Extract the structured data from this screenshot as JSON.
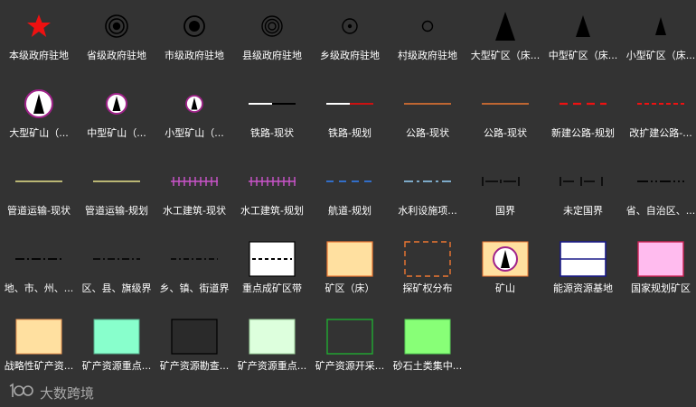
{
  "legend": [
    {
      "id": "r0c0",
      "icon": "red-star-icon",
      "label": "本级政府驻地"
    },
    {
      "id": "r0c1",
      "icon": "triple-ring-dot-icon",
      "label": "省级政府驻地"
    },
    {
      "id": "r0c2",
      "icon": "double-ring-dot-icon",
      "label": "市级政府驻地"
    },
    {
      "id": "r0c3",
      "icon": "triple-ring-icon",
      "label": "县级政府驻地"
    },
    {
      "id": "r0c4",
      "icon": "ring-dot-icon",
      "label": "乡级政府驻地"
    },
    {
      "id": "r0c5",
      "icon": "small-ring-icon",
      "label": "村级政府驻地"
    },
    {
      "id": "r0c6",
      "icon": "large-triangle-icon",
      "label": "大型矿区（床..."
    },
    {
      "id": "r0c7",
      "icon": "medium-triangle-icon",
      "label": "中型矿区（床..."
    },
    {
      "id": "r0c8",
      "icon": "small-triangle-icon",
      "label": "小型矿区（床..."
    },
    {
      "id": "r1c0",
      "icon": "large-mine-circle-icon",
      "label": "大型矿山（..."
    },
    {
      "id": "r1c1",
      "icon": "medium-mine-circle-icon",
      "label": "中型矿山（..."
    },
    {
      "id": "r1c2",
      "icon": "small-mine-circle-icon",
      "label": "小型矿山（..."
    },
    {
      "id": "r1c3",
      "icon": "railway-current-line-icon",
      "label": "铁路-现状"
    },
    {
      "id": "r1c4",
      "icon": "railway-planned-line-icon",
      "label": "铁路-规划"
    },
    {
      "id": "r1c5",
      "icon": "highway-current-line-icon",
      "label": "公路-现状"
    },
    {
      "id": "r1c6",
      "icon": "highway-current-line-icon",
      "label": "公路-现状"
    },
    {
      "id": "r1c7",
      "icon": "new-highway-planned-line-icon",
      "label": "新建公路-规划"
    },
    {
      "id": "r1c8",
      "icon": "expansion-highway-line-icon",
      "label": "改扩建公路-..."
    },
    {
      "id": "r2c0",
      "icon": "pipeline-current-line-icon",
      "label": "管道运输-现状"
    },
    {
      "id": "r2c1",
      "icon": "pipeline-planned-line-icon",
      "label": "管道运输-规划"
    },
    {
      "id": "r2c2",
      "icon": "hydraulic-current-line-icon",
      "label": "水工建筑-现状"
    },
    {
      "id": "r2c3",
      "icon": "hydraulic-planned-line-icon",
      "label": "水工建筑-规划"
    },
    {
      "id": "r2c4",
      "icon": "waterway-planned-line-icon",
      "label": "航道-规划"
    },
    {
      "id": "r2c5",
      "icon": "water-conservancy-line-icon",
      "label": "水利设施项..."
    },
    {
      "id": "r2c6",
      "icon": "national-border-line-icon",
      "label": "国界"
    },
    {
      "id": "r2c7",
      "icon": "undetermined-border-line-icon",
      "label": "未定国界"
    },
    {
      "id": "r2c8",
      "icon": "province-boundary-line-icon",
      "label": "省、自治区、..."
    },
    {
      "id": "r3c0",
      "icon": "prefecture-boundary-line-icon",
      "label": "地、市、州、..."
    },
    {
      "id": "r3c1",
      "icon": "county-boundary-line-icon",
      "label": "区、县、旗级界"
    },
    {
      "id": "r3c2",
      "icon": "township-boundary-line-icon",
      "label": "乡、镇、街道界"
    },
    {
      "id": "r3c3",
      "icon": "key-mining-zone-icon",
      "label": "重点成矿区带"
    },
    {
      "id": "r3c4",
      "icon": "mining-area-fill-icon",
      "label": "矿区（床）"
    },
    {
      "id": "r3c5",
      "icon": "exploration-right-icon",
      "label": "探矿权分布"
    },
    {
      "id": "r3c6",
      "icon": "mine-fill-icon",
      "label": "矿山"
    },
    {
      "id": "r3c7",
      "icon": "energy-base-icon",
      "label": "能源资源基地"
    },
    {
      "id": "r3c8",
      "icon": "national-planned-mining-icon",
      "label": "国家规划矿区"
    },
    {
      "id": "r4c0",
      "icon": "strategic-mineral-fill-icon",
      "label": "战略性矿产资..."
    },
    {
      "id": "r4c1",
      "icon": "key-mineral-fill-icon",
      "label": "矿产资源重点..."
    },
    {
      "id": "r4c2",
      "icon": "mineral-survey-fill-icon",
      "label": "矿产资源勘查..."
    },
    {
      "id": "r4c3",
      "icon": "key-mineral-light-fill-icon",
      "label": "矿产资源重点..."
    },
    {
      "id": "r4c4",
      "icon": "mineral-development-fill-icon",
      "label": "矿产资源开采..."
    },
    {
      "id": "r4c5",
      "icon": "sand-gravel-fill-icon",
      "label": "砂石土类集中..."
    }
  ],
  "watermark": {
    "icon": "brand-logo-icon",
    "text": "大数跨境"
  },
  "colors": {
    "background": "#333333",
    "red": "#ee1111",
    "magenta": "#cc3399",
    "yellow": "#e8e28a",
    "orange": "#ee7733"
  }
}
